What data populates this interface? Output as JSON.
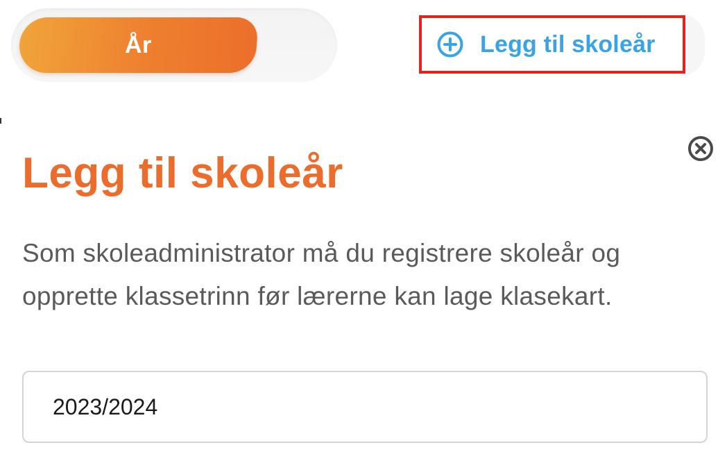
{
  "tabs": {
    "year_label": "År"
  },
  "add_button": {
    "label": "Legg til skoleår",
    "icon": "plus-circle-icon",
    "color": "#3aa3e6"
  },
  "dialog": {
    "title": "Legg til skoleår",
    "description": "Som skoleadministrator må du registrere skoleår og opprette klassetrinn før lærerne kan lage klasekart.",
    "close_icon": "close-circle-icon",
    "input_value": "2023/2024"
  },
  "colors": {
    "accent_orange": "#ec6c2c",
    "highlight_red": "#e2241f",
    "link_blue": "#3aa3e6"
  }
}
